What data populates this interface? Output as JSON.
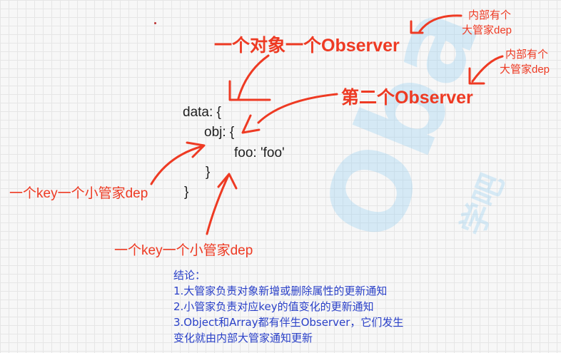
{
  "watermark": {
    "brand": "Oba",
    "sub": "学吧"
  },
  "code": {
    "line1": "data: {",
    "line2": "obj: {",
    "line3": "foo: 'foo'",
    "line4": "}",
    "line5": "}"
  },
  "labels": {
    "object_observer": "一个对象一个Observer",
    "second_observer": "第二个Observer",
    "inner_dep_1_line1": "内部有个",
    "inner_dep_1_line2": "大管家dep",
    "inner_dep_2_line1": "内部有个",
    "inner_dep_2_line2": "大管家dep",
    "key_dep_left": "一个key一个小管家dep",
    "key_dep_bottom": "一个key一个小管家dep"
  },
  "conclusion": {
    "title": "结论：",
    "items": [
      "1.大管家负责对象新增或删除属性的更新通知",
      "2.小管家负责对应key的值变化的更新通知",
      "3.Object和Array都有伴生Observer，它们发生",
      "变化就由内部大管家通知更新"
    ]
  },
  "colors": {
    "annotation": "#ee3a23",
    "conclusion": "#2a40c8",
    "code": "#1f1f1f",
    "watermark": "#96cdf0"
  }
}
